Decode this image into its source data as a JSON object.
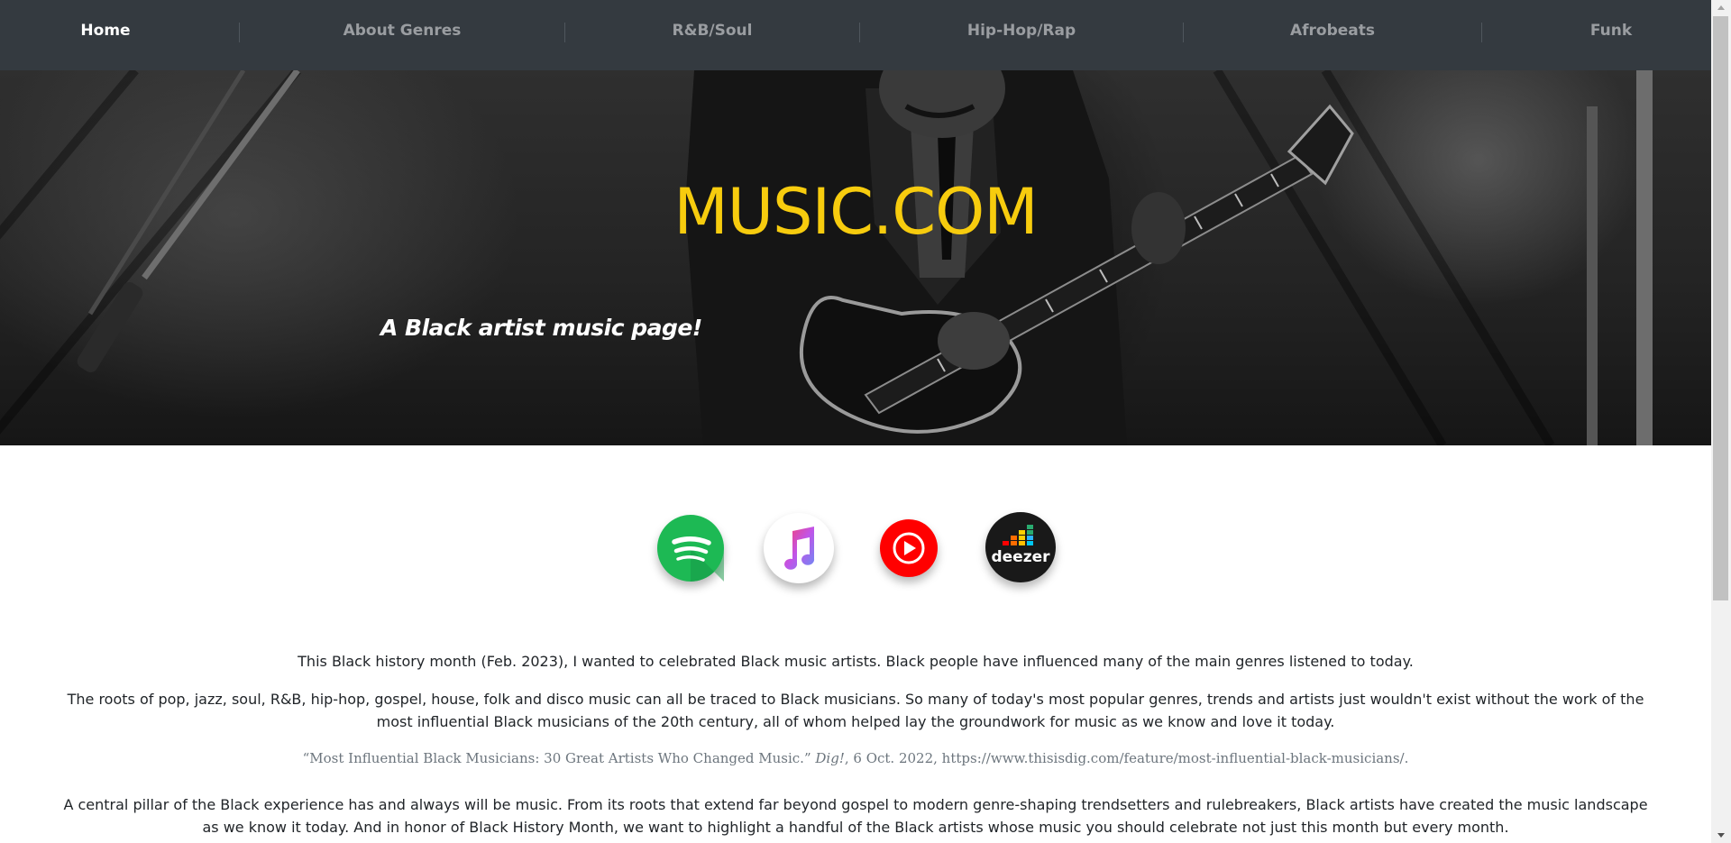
{
  "nav": {
    "items": [
      {
        "label": "Home",
        "active": true
      },
      {
        "label": "About Genres",
        "active": false
      },
      {
        "label": "R&B/Soul",
        "active": false
      },
      {
        "label": "Hip-Hop/Rap",
        "active": false
      },
      {
        "label": "Afrobeats",
        "active": false
      },
      {
        "label": "Funk",
        "active": false
      }
    ]
  },
  "hero": {
    "title": "MUSIC.COM",
    "subtitle": "A Black artist music page!"
  },
  "streaming_icons": [
    {
      "name": "spotify-icon",
      "color": "#1db954"
    },
    {
      "name": "apple-music-icon",
      "color": "#ffffff"
    },
    {
      "name": "youtube-music-icon",
      "color": "#ff0000"
    },
    {
      "name": "deezer-icon",
      "color": "#191919",
      "label": "deezer"
    }
  ],
  "content": {
    "intro": "This Black history month (Feb. 2023), I wanted to celebrated Black music artists. Black people have influenced many of the main genres listened to today.",
    "roots": "The roots of pop, jazz, soul, R&B, hip-hop, gospel, house, folk and disco music can all be traced to Black musicians. So many of today's most popular genres, trends and artists just wouldn't exist without the work of the most influential Black musicians of the 20th century, all of whom helped lay the groundwork for music as we know and love it today.",
    "citation": {
      "before": "“Most Influential Black Musicians: 30 Great Artists Who Changed Music.” ",
      "source": "Dig!",
      "after": ", 6 Oct. 2022, https://www.thisisdig.com/feature/most-influential-black-musicians/."
    },
    "pillar": "A central pillar of the Black experience has and always will be music. From its roots that extend far beyond gospel to modern genre-shaping trendsetters and rulebreakers, Black artists have created the music landscape as we know it today. And in honor of Black History Month, we want to highlight a handful of the Black artists whose music you should celebrate not just this month but every month."
  },
  "colors": {
    "navbar": "#343a40",
    "nav_active": "#ffffff",
    "nav_inactive": "#9a9da1",
    "hero_title": "#f7cc0e"
  }
}
